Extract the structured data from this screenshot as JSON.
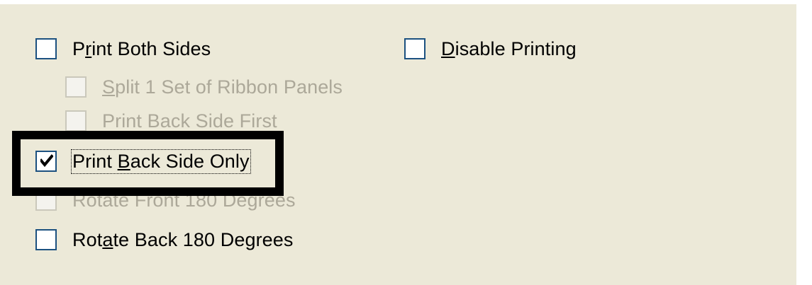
{
  "options": {
    "print_both_sides": {
      "pre": "P",
      "key": "r",
      "post": "int Both Sides",
      "checked": false,
      "enabled": true
    },
    "split_ribbon": {
      "pre": "",
      "key": "S",
      "post": "plit 1 Set of Ribbon Panels",
      "checked": false,
      "enabled": false
    },
    "print_back_first": {
      "pre": "Print Back Side First",
      "key": "",
      "post": "",
      "checked": false,
      "enabled": false
    },
    "print_back_only": {
      "pre": "Print ",
      "key": "B",
      "post": "ack Side Only",
      "checked": true,
      "enabled": true
    },
    "rotate_front": {
      "pre": "Rotate Front 180 Degrees",
      "key": "",
      "post": "",
      "checked": false,
      "enabled": false
    },
    "rotate_back": {
      "pre": "Rot",
      "key": "a",
      "post": "te Back 180 Degrees",
      "checked": false,
      "enabled": true
    },
    "disable_printing": {
      "pre": "",
      "key": "D",
      "post": "isable Printing",
      "checked": false,
      "enabled": true
    }
  },
  "colors": {
    "panel_bg": "#ece9d8",
    "checkbox_border": "#1c5180",
    "disabled_text": "#aca899",
    "highlight": "#000000"
  },
  "icons": {
    "check": "check-mark-icon"
  }
}
